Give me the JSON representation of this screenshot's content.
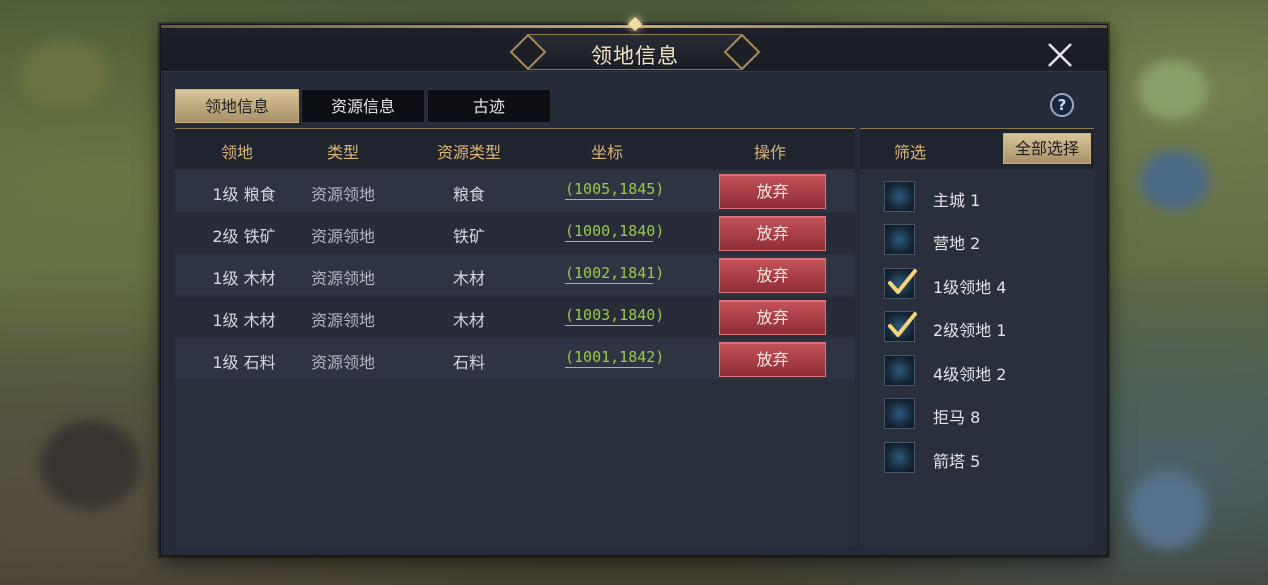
{
  "window": {
    "title": "领地信息",
    "help_label": "?"
  },
  "tabs": [
    {
      "label": "领地信息",
      "active": true
    },
    {
      "label": "资源信息",
      "active": false
    },
    {
      "label": "古迹",
      "active": false
    }
  ],
  "table": {
    "headers": [
      "领地",
      "类型",
      "资源类型",
      "坐标",
      "操作"
    ],
    "rows": [
      {
        "territory": "1级 粮食",
        "type": "资源领地",
        "resource": "粮食",
        "coord": "(1005,1845)",
        "action": "放弃"
      },
      {
        "territory": "2级 铁矿",
        "type": "资源领地",
        "resource": "铁矿",
        "coord": "(1000,1840)",
        "action": "放弃"
      },
      {
        "territory": "1级 木材",
        "type": "资源领地",
        "resource": "木材",
        "coord": "(1002,1841)",
        "action": "放弃"
      },
      {
        "territory": "1级 木材",
        "type": "资源领地",
        "resource": "木材",
        "coord": "(1003,1840)",
        "action": "放弃"
      },
      {
        "territory": "1级 石料",
        "type": "资源领地",
        "resource": "石料",
        "coord": "(1001,1842)",
        "action": "放弃"
      }
    ]
  },
  "filter": {
    "title": "筛选",
    "select_all_label": "全部选择",
    "items": [
      {
        "label": "主城 1",
        "checked": false
      },
      {
        "label": "营地 2",
        "checked": false
      },
      {
        "label": "1级领地 4",
        "checked": true
      },
      {
        "label": "2级领地 1",
        "checked": true
      },
      {
        "label": "4级领地 2",
        "checked": false
      },
      {
        "label": "拒马 8",
        "checked": false
      },
      {
        "label": "箭塔 5",
        "checked": false
      }
    ]
  },
  "colors": {
    "panel_bg": "#262b38",
    "gold_text": "#d8b678",
    "coord_green": "#99c84a",
    "abandon_red": "#b0404a",
    "tab_active": "#c9b286"
  },
  "icons": {
    "close": "close-icon",
    "help": "help-icon",
    "check": "checkmark-icon"
  }
}
